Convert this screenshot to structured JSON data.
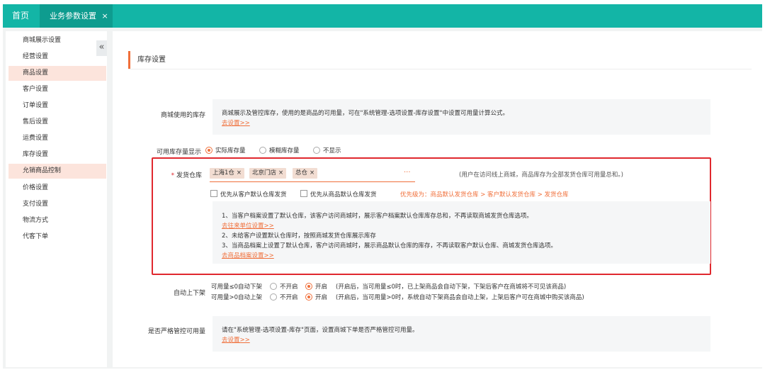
{
  "tabs": {
    "home": "首页",
    "active": "业务参数设置",
    "close_glyph": "×"
  },
  "sidebar": {
    "collapse_glyph": "«",
    "items": [
      {
        "label": "商城展示设置"
      },
      {
        "label": "经营设置"
      },
      {
        "label": "商品设置"
      },
      {
        "label": "客户设置"
      },
      {
        "label": "订单设置"
      },
      {
        "label": "售后设置"
      },
      {
        "label": "运费设置"
      },
      {
        "label": "库存设置"
      },
      {
        "label": "允销商品控制"
      },
      {
        "label": "价格设置"
      },
      {
        "label": "支付设置"
      },
      {
        "label": "物流方式"
      },
      {
        "label": "代客下单"
      }
    ]
  },
  "section": {
    "title": "库存设置"
  },
  "mall_stock": {
    "label": "商城使用的库存",
    "desc": "商城展示及管控库存，使用的是商品的可用量，可在\"系统管理-选项设置-库存设置\"中设置可用量计算公式。",
    "link": "去设置>>"
  },
  "display": {
    "label": "可用库存量显示",
    "options": [
      "实际库存量",
      "模糊库存量",
      "不显示"
    ],
    "selected": "实际库存量"
  },
  "warehouse": {
    "required_mark": "*",
    "label": "发货仓库",
    "tags": [
      "上海1仓",
      "北京门店",
      "总仓"
    ],
    "tag_close": "×",
    "more": "···",
    "hint": "(用户在访问线上商城，商品库存为全部发货仓库可用量总和。)",
    "check_customer": "优先从客户默认仓库发货",
    "check_product": "优先从商品默认仓库发货",
    "priority": "优先级为：商品默认发货仓库 > 客户默认发货仓库 > 发货仓库",
    "notes": [
      "1、当客户档案设置了默认仓库，该客户访问商城时，展示客户档案默认仓库库存总和，不再读取商城发货仓库选项。",
      "2、未给客户设置默认仓库时，按照商城发货仓库展示库存",
      "3、当商品档案上设置了默认仓库，客户访问商城时，展示商品默认仓库的库存，不再读取客户默认仓库、商城发货仓库选项。"
    ],
    "link1": "去往来单位设置>>",
    "link2": "去商品档案设置>>"
  },
  "auto_shelf": {
    "label": "自动上下架",
    "row1_label": "可用量≤0自动下架",
    "row2_label": "可用量>0自动上架",
    "off": "不开启",
    "on": "开启",
    "row1_note": "(开启后，当可用量≤0时，已上架商品会自动下架，下架后客户在商城将不可见该商品)",
    "row2_note": "(开启后，当可用量>0时，系统自动下架商品会自动上架，上架后客户可在商城中购买该商品)"
  },
  "strict": {
    "label": "是否严格管控可用量",
    "desc": "请在\"系统管理-选项设置-库存\"页面，设置商城下单是否严格管控可用量。",
    "link": "去设置>>"
  }
}
